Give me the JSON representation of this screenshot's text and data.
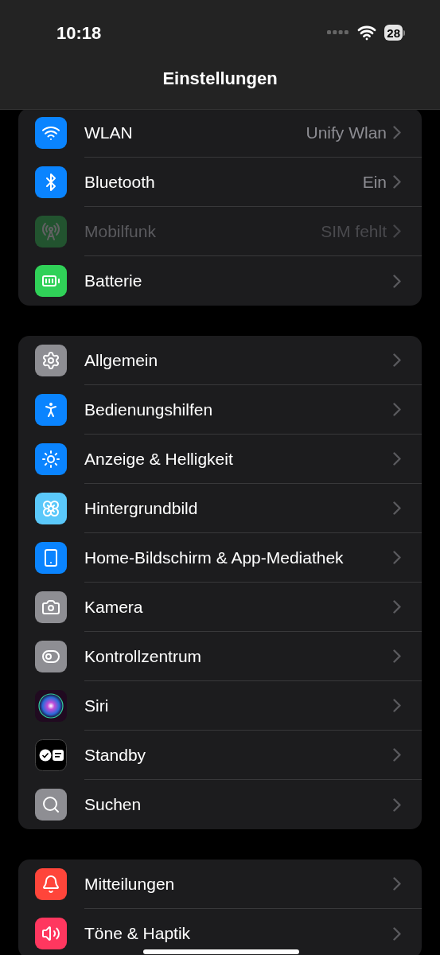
{
  "status_bar": {
    "time": "10:18",
    "battery": "28"
  },
  "header": {
    "title": "Einstellungen"
  },
  "groups": [
    {
      "items": [
        {
          "kind": "wifi",
          "label": "WLAN",
          "value": "Unify Wlan",
          "disabled": false
        },
        {
          "kind": "bluetooth",
          "label": "Bluetooth",
          "value": "Ein",
          "disabled": false
        },
        {
          "kind": "cellular",
          "label": "Mobilfunk",
          "value": "SIM fehlt",
          "disabled": true
        },
        {
          "kind": "battery",
          "label": "Batterie",
          "disabled": false
        }
      ]
    },
    {
      "items": [
        {
          "kind": "general",
          "label": "Allgemein",
          "disabled": false
        },
        {
          "kind": "accessibility",
          "label": "Bedienungshilfen",
          "disabled": false
        },
        {
          "kind": "display",
          "label": "Anzeige & Helligkeit",
          "disabled": false
        },
        {
          "kind": "wallpaper",
          "label": "Hintergrundbild",
          "disabled": false
        },
        {
          "kind": "homescreen",
          "label": "Home-Bildschirm & App-Mediathek",
          "disabled": false
        },
        {
          "kind": "camera",
          "label": "Kamera",
          "disabled": false
        },
        {
          "kind": "control",
          "label": "Kontrollzentrum",
          "disabled": false
        },
        {
          "kind": "siri",
          "label": "Siri",
          "disabled": false
        },
        {
          "kind": "standby",
          "label": "Standby",
          "disabled": false
        },
        {
          "kind": "search",
          "label": "Suchen",
          "disabled": false
        }
      ]
    },
    {
      "items": [
        {
          "kind": "notifications",
          "label": "Mitteilungen",
          "disabled": false
        },
        {
          "kind": "sounds",
          "label": "Töne & Haptik",
          "disabled": false
        }
      ]
    }
  ]
}
